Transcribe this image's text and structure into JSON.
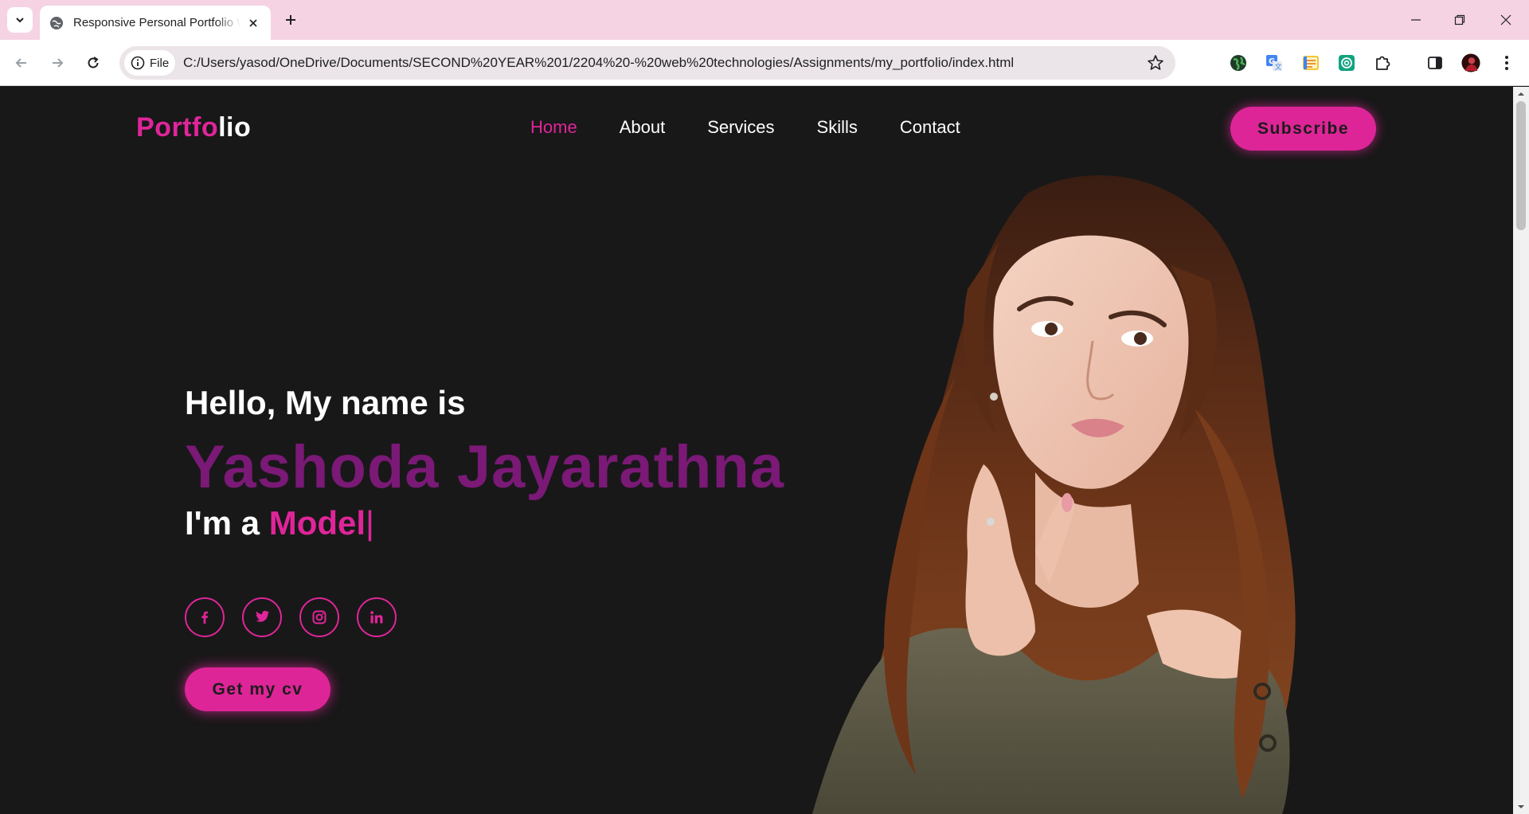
{
  "browser": {
    "tab_title": "Responsive Personal Portfolio W",
    "address_scheme": "File",
    "url": "C:/Users/yasod/OneDrive/Documents/SECOND%20YEAR%201/2204%20-%20web%20technologies/Assignments/my_portfolio/index.html"
  },
  "site": {
    "logo_part1": "Portfo",
    "logo_part2": "lio",
    "nav": [
      {
        "label": "Home",
        "active": true
      },
      {
        "label": "About",
        "active": false
      },
      {
        "label": "Services",
        "active": false
      },
      {
        "label": "Skills",
        "active": false
      },
      {
        "label": "Contact",
        "active": false
      }
    ],
    "subscribe_label": "Subscribe"
  },
  "hero": {
    "greeting": "Hello, My name is",
    "name": "Yashoda Jayarathna",
    "role_prefix": "I'm a ",
    "role_word": "Model",
    "caret": "|",
    "socials": [
      "facebook-icon",
      "twitter-icon",
      "instagram-icon",
      "linkedin-icon"
    ],
    "cv_label": "Get my cv"
  },
  "colors": {
    "accent": "#e0259a",
    "name_purple": "#7a1976",
    "background": "#181818",
    "tabstrip": "#f5d3e3"
  }
}
